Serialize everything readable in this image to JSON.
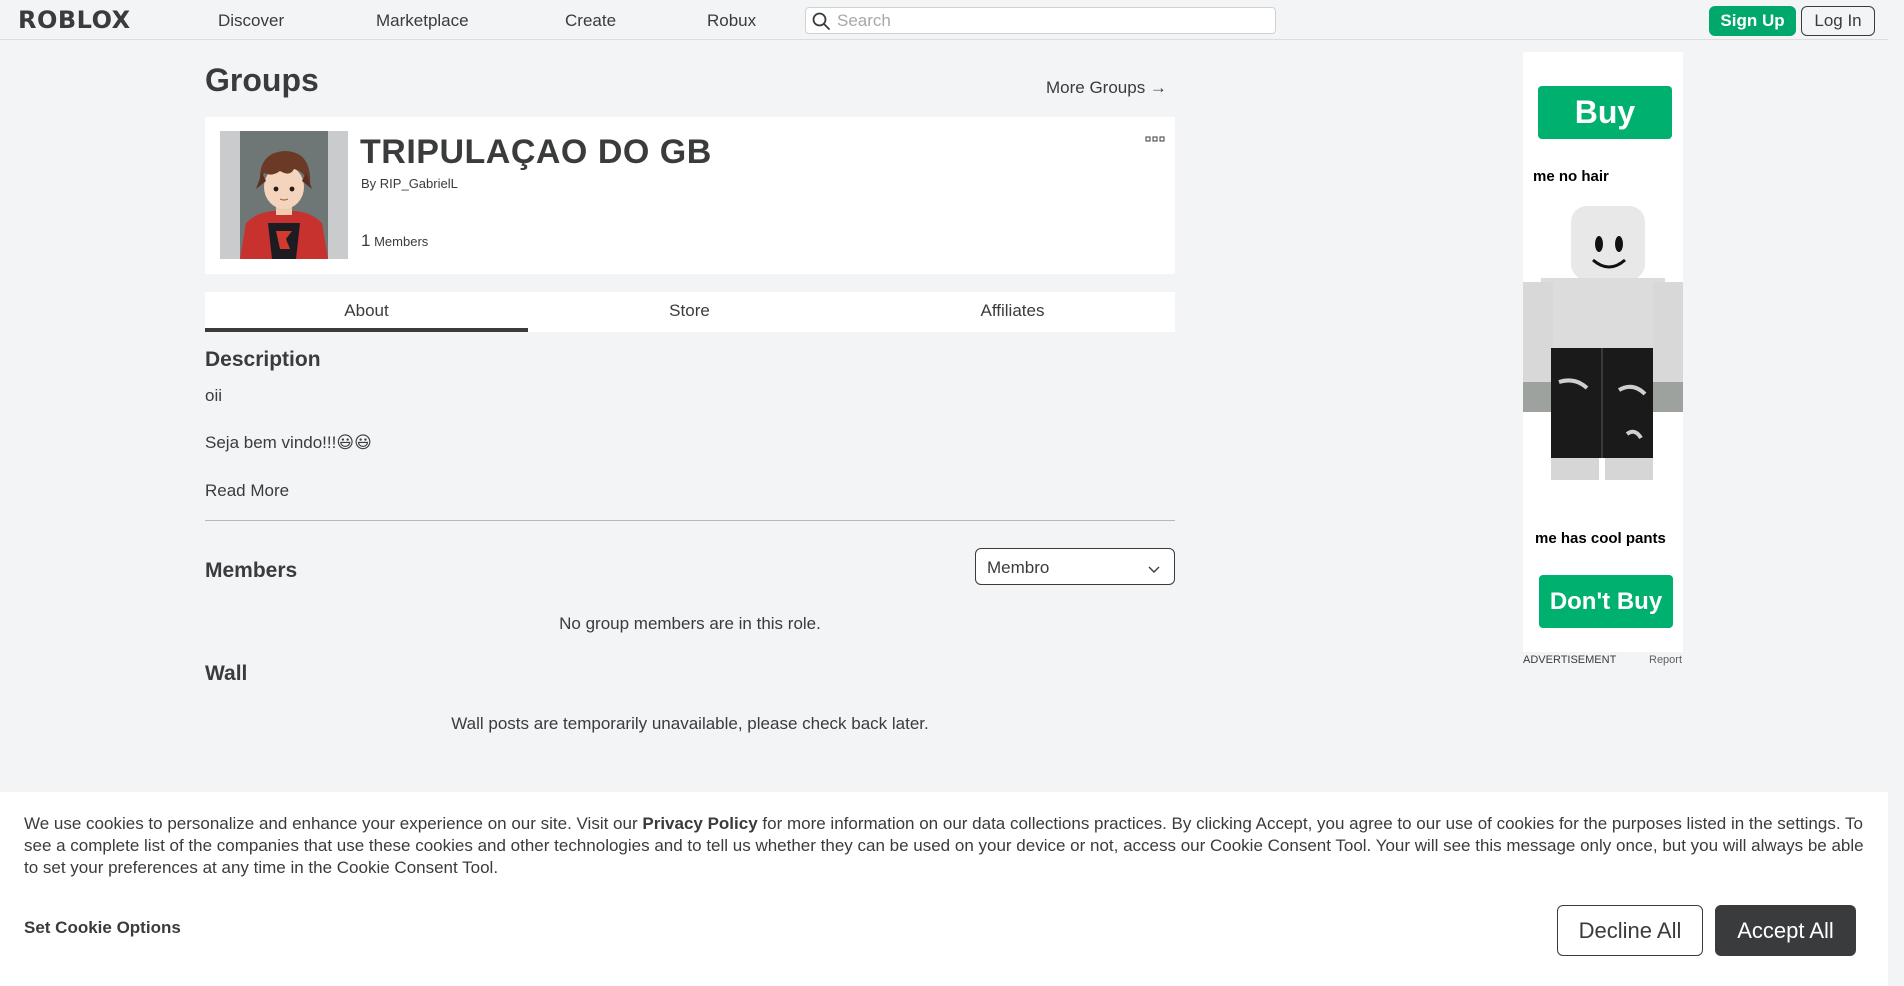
{
  "nav": {
    "logo": "ROBLOX",
    "links": [
      "Discover",
      "Marketplace",
      "Create",
      "Robux"
    ],
    "search_placeholder": "Search",
    "signup_label": "Sign Up",
    "login_label": "Log In"
  },
  "page": {
    "title": "Groups",
    "more_groups": "More Groups →"
  },
  "group": {
    "name": "TRIPULAÇAO DO GB",
    "by_prefix": "By ",
    "owner": "RIP_GabrielL",
    "member_count": "1",
    "members_label": "Members"
  },
  "tabs": [
    "About",
    "Store",
    "Affiliates"
  ],
  "active_tab": "About",
  "description": {
    "title": "Description",
    "lines": [
      "oii",
      "Seja bem vindo!!!😃😃"
    ],
    "read_more": "Read More"
  },
  "members": {
    "title": "Members",
    "role_selected": "Membro",
    "empty_message": "No group members are in this role."
  },
  "wall": {
    "title": "Wall",
    "message": "Wall posts are temporarily unavailable, please check back later."
  },
  "ad": {
    "buy_label": "Buy",
    "caption_top": "me no hair",
    "caption_bottom": "me  has cool pants",
    "dont_buy_label": "Don't Buy",
    "advertisement_label": "ADVERTISEMENT",
    "report_label": "Report"
  },
  "cookie": {
    "text_before": "We use cookies to personalize and enhance your experience on our site. Visit our ",
    "privacy_link": "Privacy Policy",
    "text_after": " for more information on our data collections practices. By clicking Accept, you agree to our use of cookies for the purposes listed in the settings. To see a complete list of the companies that use these cookies and other technologies and to tell us whether they can be used on your device or not, access our Cookie Consent Tool. Your will see this message only once, but you will always be able to set your preferences at any time in the Cookie Consent Tool.",
    "set_options": "Set Cookie Options",
    "decline_label": "Decline All",
    "accept_label": "Accept All"
  },
  "colors": {
    "accent_green": "#00a86b",
    "text_dark": "#393b3d",
    "page_bg": "#f2f4f5"
  }
}
